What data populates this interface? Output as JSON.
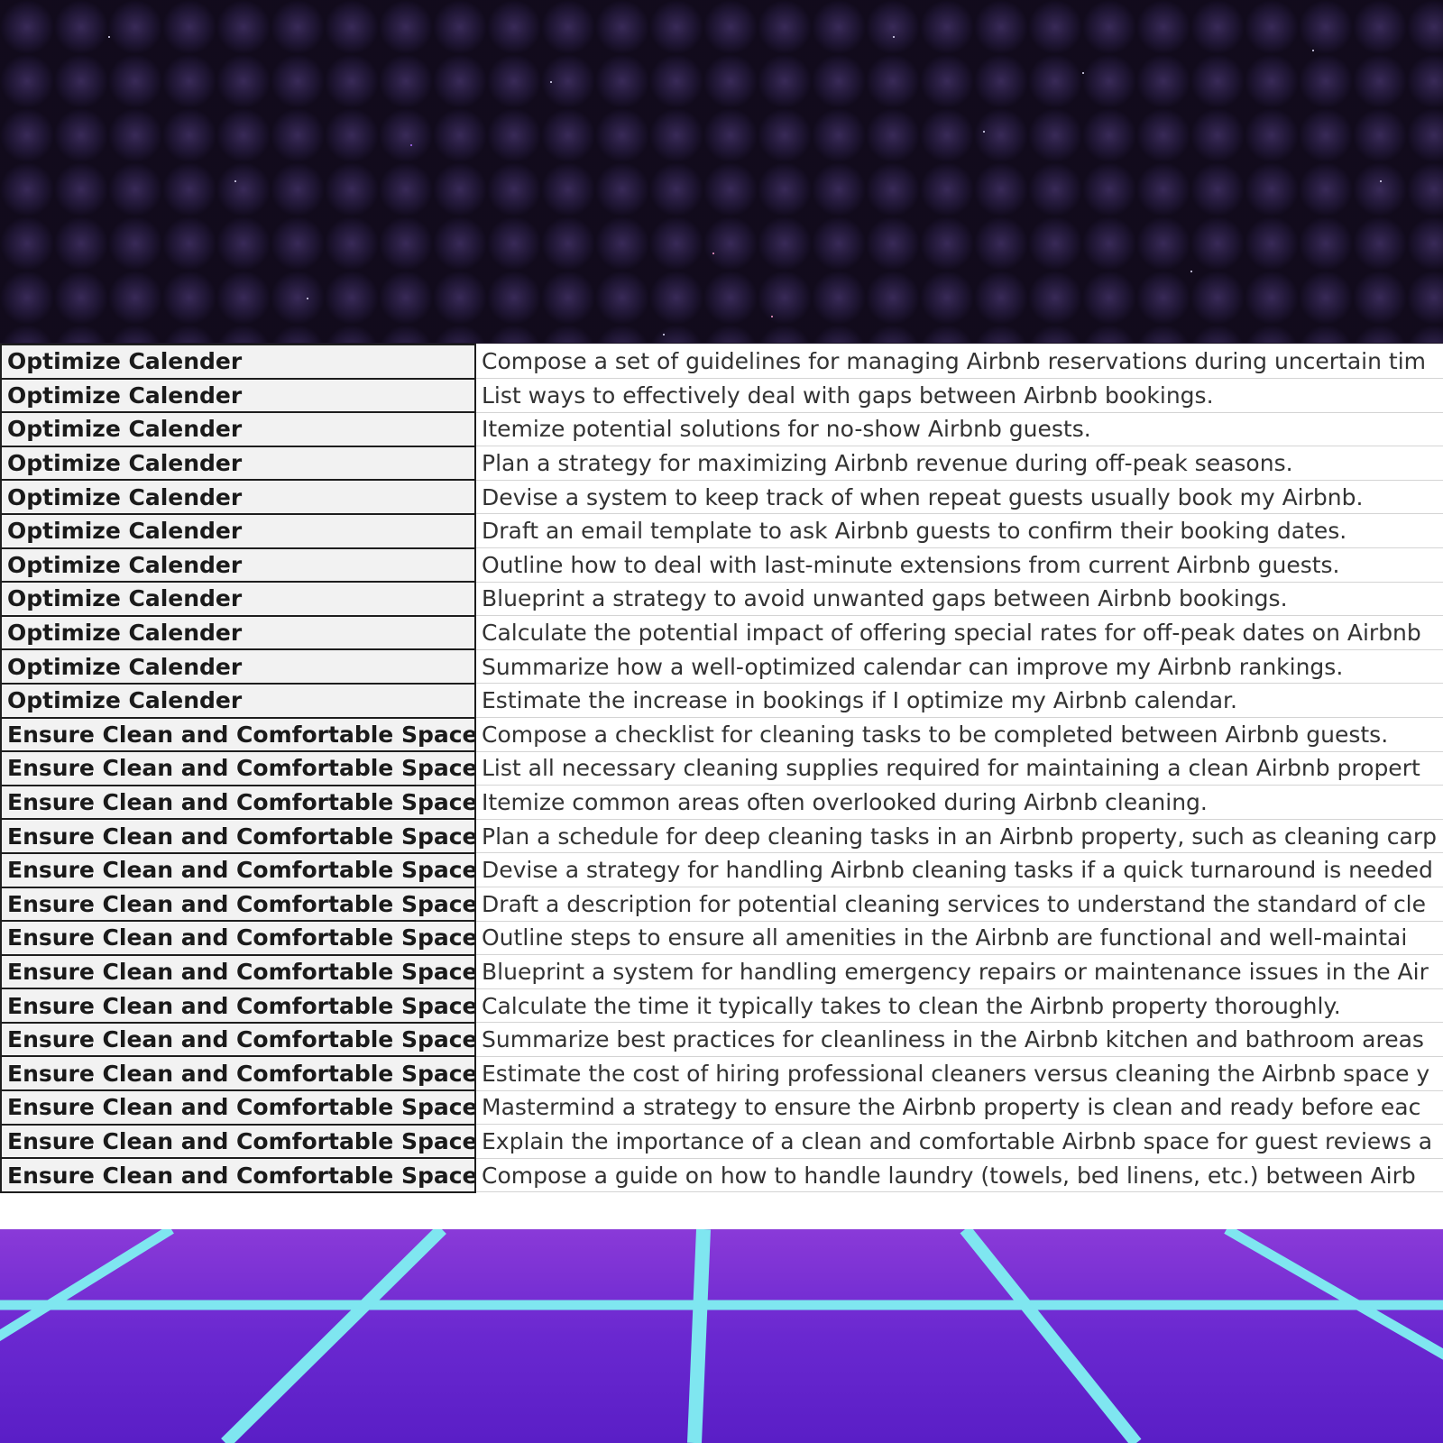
{
  "rows": [
    {
      "category": "Optimize Calender",
      "prompt": "Compose a set of guidelines for managing Airbnb reservations during uncertain tim"
    },
    {
      "category": "Optimize Calender",
      "prompt": "List ways to effectively deal with gaps between Airbnb bookings."
    },
    {
      "category": "Optimize Calender",
      "prompt": "Itemize potential solutions for no-show Airbnb guests."
    },
    {
      "category": "Optimize Calender",
      "prompt": "Plan a strategy for maximizing Airbnb revenue during off-peak seasons."
    },
    {
      "category": "Optimize Calender",
      "prompt": "Devise a system to keep track of when repeat guests usually book my Airbnb."
    },
    {
      "category": "Optimize Calender",
      "prompt": "Draft an email template to ask Airbnb guests to confirm their booking dates."
    },
    {
      "category": "Optimize Calender",
      "prompt": "Outline how to deal with last-minute extensions from current Airbnb guests."
    },
    {
      "category": "Optimize Calender",
      "prompt": "Blueprint a strategy to avoid unwanted gaps between Airbnb bookings."
    },
    {
      "category": "Optimize Calender",
      "prompt": "Calculate the potential impact of offering special rates for off-peak dates on Airbnb"
    },
    {
      "category": "Optimize Calender",
      "prompt": "Summarize how a well-optimized calendar can improve my Airbnb rankings."
    },
    {
      "category": "Optimize Calender",
      "prompt": "Estimate the increase in bookings if I optimize my Airbnb calendar."
    },
    {
      "category": "Ensure Clean and Comfortable Space",
      "prompt": "Compose a checklist for cleaning tasks to be completed between Airbnb guests."
    },
    {
      "category": "Ensure Clean and Comfortable Space",
      "prompt": "List all necessary cleaning supplies required for maintaining a clean Airbnb propert"
    },
    {
      "category": "Ensure Clean and Comfortable Space",
      "prompt": "Itemize common areas often overlooked during Airbnb cleaning."
    },
    {
      "category": "Ensure Clean and Comfortable Space",
      "prompt": "Plan a schedule for deep cleaning tasks in an Airbnb property, such as cleaning carp"
    },
    {
      "category": "Ensure Clean and Comfortable Space",
      "prompt": "Devise a strategy for handling Airbnb cleaning tasks if a quick turnaround is needed"
    },
    {
      "category": "Ensure Clean and Comfortable Space",
      "prompt": "Draft a description for potential cleaning services to understand the standard of cle"
    },
    {
      "category": "Ensure Clean and Comfortable Space",
      "prompt": "Outline steps to ensure all amenities in the Airbnb are functional and well-maintai"
    },
    {
      "category": "Ensure Clean and Comfortable Space",
      "prompt": "Blueprint a system for handling emergency repairs or maintenance issues in the Air"
    },
    {
      "category": "Ensure Clean and Comfortable Space",
      "prompt": "Calculate the time it typically takes to clean the Airbnb property thoroughly."
    },
    {
      "category": "Ensure Clean and Comfortable Space",
      "prompt": "Summarize best practices for cleanliness in the Airbnb kitchen and bathroom areas"
    },
    {
      "category": "Ensure Clean and Comfortable Space",
      "prompt": "Estimate the cost of hiring professional cleaners versus cleaning the Airbnb space y"
    },
    {
      "category": "Ensure Clean and Comfortable Space",
      "prompt": "Mastermind a strategy to ensure the Airbnb property is clean and ready before eac"
    },
    {
      "category": "Ensure Clean and Comfortable Space",
      "prompt": "Explain the importance of a clean and comfortable Airbnb space for guest reviews a"
    },
    {
      "category": "Ensure Clean and Comfortable Space",
      "prompt": "Compose a guide on how to handle laundry (towels, bed linens, etc.) between Airb"
    }
  ],
  "colors": {
    "grid_line": "#7fe6f0",
    "floor_top": "#8a3ad8",
    "floor_bottom": "#5a1ec6",
    "space_bg": "#1c1430"
  }
}
